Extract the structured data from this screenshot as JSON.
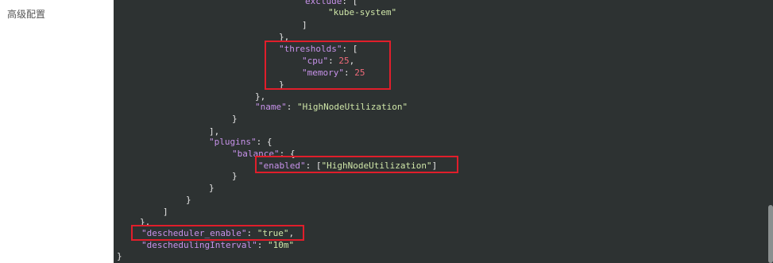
{
  "sidebar": {
    "label": "高级配置"
  },
  "colors": {
    "highlight": "#e01e2b",
    "editor_bg": "#2d3232"
  },
  "code": {
    "l1_key": "exclude",
    "l1_rest": ": [",
    "l2": "\"kube-system\"",
    "l3": "]",
    "l4": "},",
    "l5_key": "\"thresholds\"",
    "l5_rest": ": [",
    "l6_key": "\"cpu\"",
    "l6_sep": ": ",
    "l6_val": "25",
    "l6_end": ",",
    "l7_key": "\"memory\"",
    "l7_sep": ": ",
    "l7_val": "25",
    "l8": "}",
    "l9": "},",
    "l10_key": "\"name\"",
    "l10_sep": ": ",
    "l10_val": "\"HighNodeUtilization\"",
    "l11": "}",
    "l12": "],",
    "l13_key": "\"plugins\"",
    "l13_rest": ": {",
    "l14_key": "\"balance\"",
    "l14_rest": ": {",
    "l15_key": "\"enabled\"",
    "l15_sep": ": [",
    "l15_val": "\"HighNodeUtilization\"",
    "l15_end": "]",
    "l16": "}",
    "l17": "}",
    "l18": "}",
    "l19": "]",
    "l20": "},",
    "l21_key": "\"descheduler_enable\"",
    "l21_sep": ": ",
    "l21_val": "\"true\"",
    "l21_end": ",",
    "l22_key": "\"deschedulingInterval\"",
    "l22_sep": ": ",
    "l22_val": "\"10m\"",
    "l23": "}"
  }
}
